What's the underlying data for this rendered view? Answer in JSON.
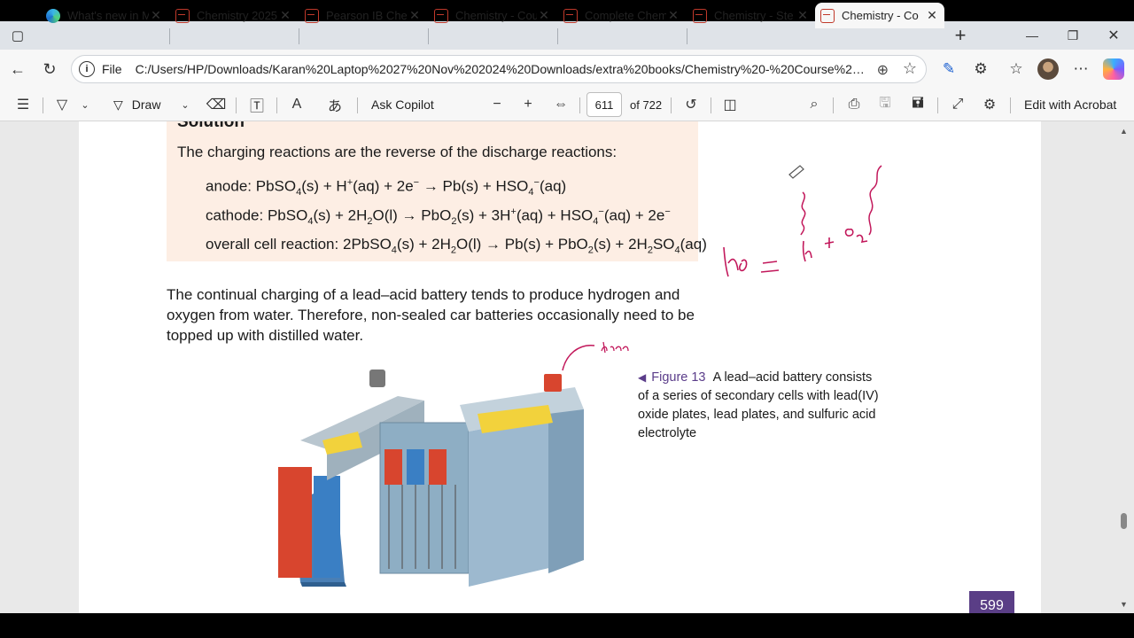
{
  "browser": {
    "tabs": [
      {
        "title": "What's new in M",
        "icon": "edge-icon"
      },
      {
        "title": "Chemistry 2025",
        "icon": "pdf-icon"
      },
      {
        "title": "Pearson IB Chem",
        "icon": "pdf-icon"
      },
      {
        "title": "Chemistry - Cou",
        "icon": "pdf-icon"
      },
      {
        "title": "Complete Chem",
        "icon": "pdf-icon"
      },
      {
        "title": "Chemistry - Ste",
        "icon": "pdf-icon"
      },
      {
        "title": "Chemistry - Co",
        "icon": "pdf-icon"
      }
    ],
    "active_tab_index": 6,
    "new_tab_symbol": "+",
    "address": {
      "scheme_label": "File",
      "url": "C:/Users/HP/Downloads/Karan%20Laptop%2027%20Nov%202024%20Downloads/extra%20books/Chemistry%20-%20Course%20Co..."
    }
  },
  "pdf_toolbar": {
    "draw_label": "Draw",
    "ask_copilot_label": "Ask Copilot",
    "current_page": "611",
    "total_pages_label": "of 722",
    "edit_acrobat_label": "Edit with Acrobat"
  },
  "document": {
    "solution_heading": "Solution",
    "intro": "The charging reactions are the reverse of the discharge reactions:",
    "anode": {
      "label": "anode:",
      "lhs": "PbSO",
      "s1": "4",
      "rest": "(s) + H",
      "sup1": "+",
      "rest2": "(aq) + 2e",
      "sup2": "−",
      "arrow": " → ",
      "rhs": "Pb(s) + HSO",
      "s2": "4",
      "sup3": "−",
      "end": "(aq)"
    },
    "cathode": {
      "label": "cathode:",
      "a": "PbSO",
      "s1": "4",
      "b": "(s) + 2H",
      "s2": "2",
      "c": "O(l) → PbO",
      "s3": "2",
      "d": "(s) + 3H",
      "sup1": "+",
      "e": "(aq) + HSO",
      "s4": "4",
      "sup2": "−",
      "f": "(aq) + 2e",
      "sup3": "−"
    },
    "overall": {
      "label": "overall cell reaction:",
      "a": "2PbSO",
      "s1": "4",
      "b": "(s) + 2H",
      "s2": "2",
      "c": "O(l) → Pb(s) + PbO",
      "s3": "2",
      "d": "(s) + 2H",
      "s4": "2",
      "e": "SO",
      "s5": "4",
      "f": "(aq)"
    },
    "paragraph": "The continual charging of a lead–acid battery tends to produce hydrogen and oxygen from water. Therefore, non-sealed car batteries occasionally need to be topped up with distilled water.",
    "figure_label": "Figure 13",
    "figure_caption": "A lead–acid battery consists of a series of secondary cells with lead(IV) oxide plates, lead plates, and sulfuric acid electrolyte",
    "page_number": "599",
    "ink_color": "#c2185b"
  }
}
